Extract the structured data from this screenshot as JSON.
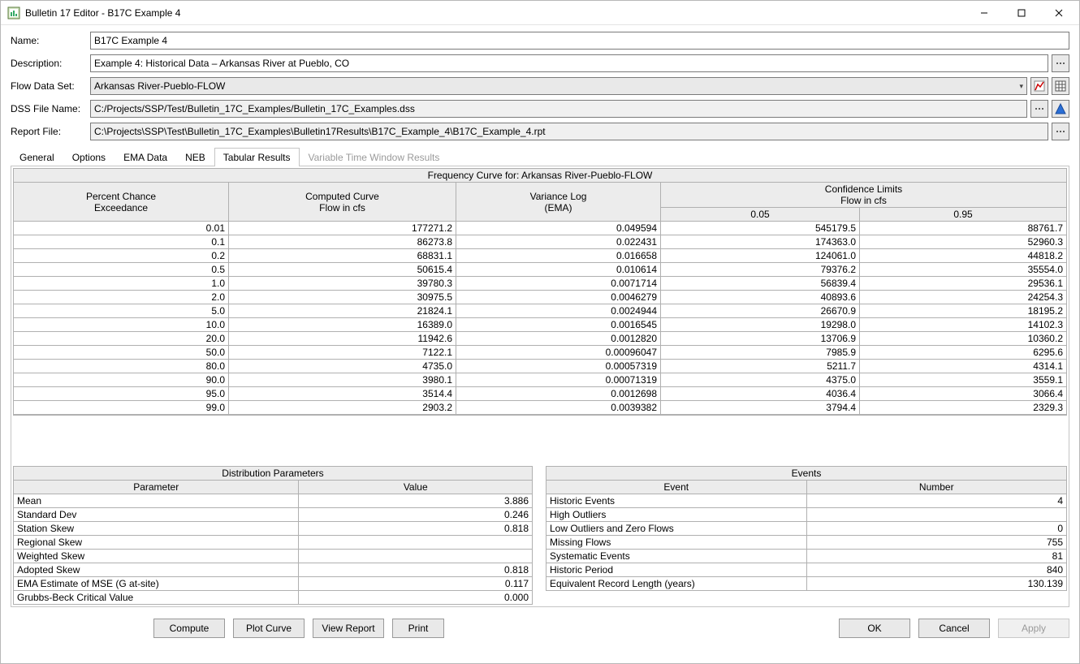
{
  "window": {
    "title": "Bulletin 17 Editor - B17C Example 4"
  },
  "form": {
    "name_label": "Name:",
    "name_value": "B17C Example 4",
    "desc_label": "Description:",
    "desc_value": "Example 4: Historical Data – Arkansas River at Pueblo, CO",
    "flowset_label": "Flow Data Set:",
    "flowset_value": "Arkansas River-Pueblo-FLOW",
    "dss_label": "DSS File Name:",
    "dss_value": "C:/Projects/SSP/Test/Bulletin_17C_Examples/Bulletin_17C_Examples.dss",
    "report_label": "Report File:",
    "report_value": "C:\\Projects\\SSP\\Test\\Bulletin_17C_Examples\\Bulletin17Results\\B17C_Example_4\\B17C_Example_4.rpt"
  },
  "tabs": {
    "general": "General",
    "options": "Options",
    "ema": "EMA Data",
    "neb": "NEB",
    "tabres": "Tabular Results",
    "varwin": "Variable Time Window Results"
  },
  "freq": {
    "title": "Frequency Curve for: Arkansas River-Pueblo-FLOW",
    "col_pce_1": "Percent Chance",
    "col_pce_2": "Exceedance",
    "col_cc_1": "Computed Curve",
    "col_cc_2": "Flow in cfs",
    "col_vl_1": "Variance Log",
    "col_vl_2": "(EMA)",
    "col_cl_1": "Confidence Limits",
    "col_cl_2": "Flow in cfs",
    "col_cl_005": "0.05",
    "col_cl_095": "0.95",
    "rows": [
      {
        "pce": "0.01",
        "cc": "177271.2",
        "vl": "0.049594",
        "c05": "545179.5",
        "c95": "88761.7"
      },
      {
        "pce": "0.1",
        "cc": "86273.8",
        "vl": "0.022431",
        "c05": "174363.0",
        "c95": "52960.3"
      },
      {
        "pce": "0.2",
        "cc": "68831.1",
        "vl": "0.016658",
        "c05": "124061.0",
        "c95": "44818.2"
      },
      {
        "pce": "0.5",
        "cc": "50615.4",
        "vl": "0.010614",
        "c05": "79376.2",
        "c95": "35554.0"
      },
      {
        "pce": "1.0",
        "cc": "39780.3",
        "vl": "0.0071714",
        "c05": "56839.4",
        "c95": "29536.1"
      },
      {
        "pce": "2.0",
        "cc": "30975.5",
        "vl": "0.0046279",
        "c05": "40893.6",
        "c95": "24254.3"
      },
      {
        "pce": "5.0",
        "cc": "21824.1",
        "vl": "0.0024944",
        "c05": "26670.9",
        "c95": "18195.2"
      },
      {
        "pce": "10.0",
        "cc": "16389.0",
        "vl": "0.0016545",
        "c05": "19298.0",
        "c95": "14102.3"
      },
      {
        "pce": "20.0",
        "cc": "11942.6",
        "vl": "0.0012820",
        "c05": "13706.9",
        "c95": "10360.2"
      },
      {
        "pce": "50.0",
        "cc": "7122.1",
        "vl": "0.00096047",
        "c05": "7985.9",
        "c95": "6295.6"
      },
      {
        "pce": "80.0",
        "cc": "4735.0",
        "vl": "0.00057319",
        "c05": "5211.7",
        "c95": "4314.1"
      },
      {
        "pce": "90.0",
        "cc": "3980.1",
        "vl": "0.00071319",
        "c05": "4375.0",
        "c95": "3559.1"
      },
      {
        "pce": "95.0",
        "cc": "3514.4",
        "vl": "0.0012698",
        "c05": "4036.4",
        "c95": "3066.4"
      },
      {
        "pce": "99.0",
        "cc": "2903.2",
        "vl": "0.0039382",
        "c05": "3794.4",
        "c95": "2329.3"
      }
    ]
  },
  "dist": {
    "title": "Distribution Parameters",
    "col_param": "Parameter",
    "col_value": "Value",
    "rows": [
      {
        "p": "Mean",
        "v": "3.886"
      },
      {
        "p": "Standard Dev",
        "v": "0.246"
      },
      {
        "p": "Station Skew",
        "v": "0.818"
      },
      {
        "p": "Regional Skew",
        "v": ""
      },
      {
        "p": "Weighted Skew",
        "v": ""
      },
      {
        "p": "Adopted Skew",
        "v": "0.818"
      },
      {
        "p": "EMA Estimate of MSE (G at-site)",
        "v": "0.117"
      },
      {
        "p": "Grubbs-Beck Critical Value",
        "v": "0.000"
      }
    ]
  },
  "events": {
    "title": "Events",
    "col_event": "Event",
    "col_number": "Number",
    "rows": [
      {
        "e": "Historic Events",
        "n": "4"
      },
      {
        "e": "High Outliers",
        "n": ""
      },
      {
        "e": "Low Outliers and Zero Flows",
        "n": "0"
      },
      {
        "e": "Missing Flows",
        "n": "755"
      },
      {
        "e": "Systematic Events",
        "n": "81"
      },
      {
        "e": "Historic Period",
        "n": "840"
      },
      {
        "e": "Equivalent Record Length (years)",
        "n": "130.139"
      }
    ]
  },
  "buttons": {
    "compute": "Compute",
    "plot": "Plot Curve",
    "report": "View Report",
    "print": "Print",
    "ok": "OK",
    "cancel": "Cancel",
    "apply": "Apply"
  }
}
